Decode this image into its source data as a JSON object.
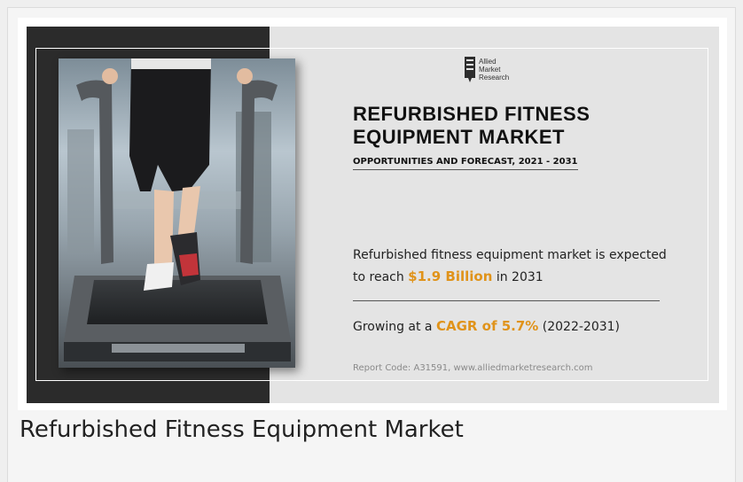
{
  "banner": {
    "brand": {
      "lines": [
        "Allied",
        "Market",
        "Research"
      ],
      "icon": "allied-market-research-logo"
    },
    "title": "REFURBISHED FITNESS EQUIPMENT MARKET",
    "subtitle": "OPPORTUNITIES AND FORECAST, 2021 - 2031",
    "market_stat": {
      "prefix": "Refurbished fitness equipment market is expected to reach ",
      "value": "$1.9 Billion",
      "suffix": " in 2031"
    },
    "growth_stat": {
      "prefix": "Growing at a ",
      "value": "CAGR of 5.7%",
      "suffix": " (2022-2031)"
    },
    "report_code": "Report Code: A31591, www.alliedmarketresearch.com",
    "photo": {
      "icon": "person-running-on-treadmill-photo"
    },
    "colors": {
      "accent": "#e0931a",
      "dark_panel": "#2b2b2b",
      "banner_bg": "#e4e4e4"
    }
  },
  "caption": "Refurbished Fitness Equipment Market"
}
